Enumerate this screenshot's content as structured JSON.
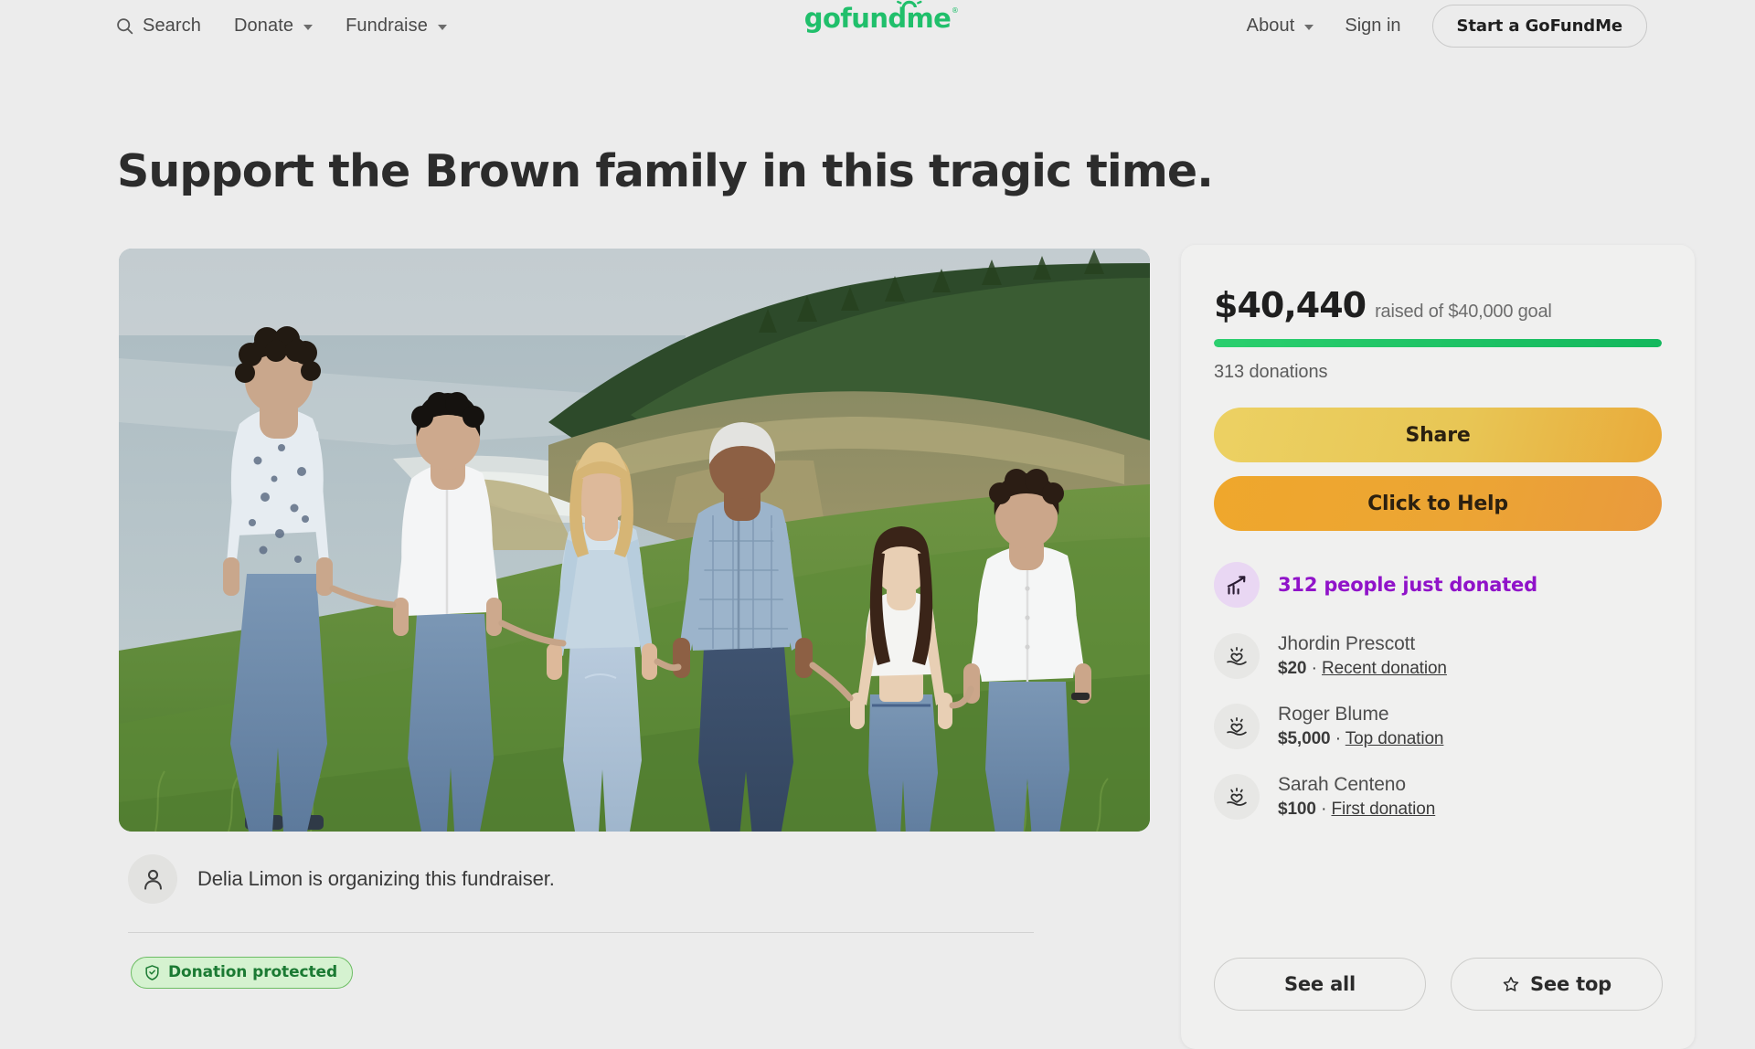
{
  "header": {
    "nav_left": [
      {
        "label": "Search",
        "icon": "search-icon",
        "has_caret": false
      },
      {
        "label": "Donate",
        "icon": null,
        "has_caret": true
      },
      {
        "label": "Fundraise",
        "icon": null,
        "has_caret": true
      }
    ],
    "logo_text": "gofundme",
    "logo_tm": "®",
    "about_label": "About",
    "signin_label": "Sign in",
    "start_button_label": "Start a GoFundMe"
  },
  "main": {
    "title": "Support the Brown family in this tragic time.",
    "hero_alt": "Family of six holding hands standing on a grassy coastal bluff",
    "organizer_text": "Delia Limon is organizing this fundraiser.",
    "protected_badge_label": "Donation protected"
  },
  "sidebar": {
    "raised_amount": "$40,440",
    "raised_goal_text": "raised of $40,000 goal",
    "progress_percent": 100,
    "donations_count_text": "313 donations",
    "share_button_label": "Share",
    "help_button_label": "Click to Help",
    "just_donated_text": "312 people just donated",
    "donors": [
      {
        "name": "Jhordin Prescott",
        "amount": "$20",
        "separator": "·",
        "tag": "Recent donation"
      },
      {
        "name": "Roger Blume",
        "amount": "$5,000",
        "separator": "·",
        "tag": "Top donation"
      },
      {
        "name": "Sarah Centeno",
        "amount": "$100",
        "separator": "·",
        "tag": "First donation"
      }
    ],
    "see_all_label": "See all",
    "see_top_label": "See top"
  },
  "colors": {
    "page_background": "#ececec",
    "brand_green": "#20bf6b",
    "progress_green": "#13b85d",
    "share_yellow": "#ecd163",
    "help_orange": "#efa72c",
    "purple_accent": "#9013c9",
    "protected_green": "#1b7a33"
  }
}
